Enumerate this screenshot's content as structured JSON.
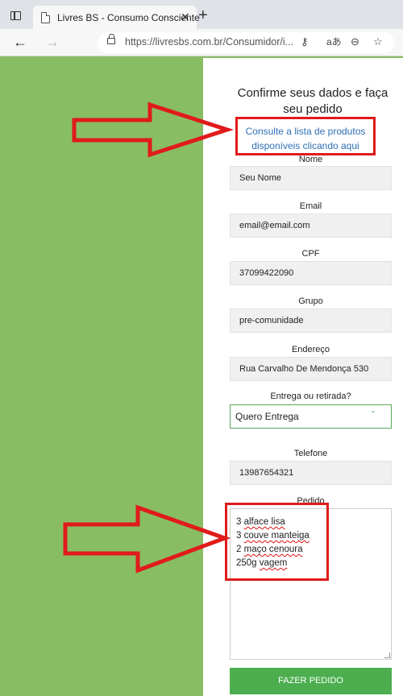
{
  "browser": {
    "tab_title": "Livres BS - Consumo Consciente",
    "tab_close": "✕",
    "new_tab": "+",
    "url": "https://livresbs.com.br/Consumidor/i...",
    "back_icon": "arrow-left-icon",
    "forward_icon": "arrow-right-icon",
    "reload_icon": "reload-icon"
  },
  "form": {
    "title": "Confirme seus dados e faça seu pedido",
    "consult_link": "Consulte a lista de produtos disponíveis clicando aqui",
    "fields": {
      "nome": {
        "label": "Nome",
        "value": "Seu Nome"
      },
      "email": {
        "label": "Email",
        "value": "email@email.com"
      },
      "cpf": {
        "label": "CPF",
        "value": "37099422090"
      },
      "grupo": {
        "label": "Grupo",
        "value": "pre-comunidade"
      },
      "endereco": {
        "label": "Endereço",
        "value": "Rua Carvalho De Mendonça 530"
      },
      "entrega": {
        "label": "Entrega ou retirada?",
        "value": "Quero Entrega"
      },
      "telefone": {
        "label": "Telefone",
        "value": "13987654321"
      },
      "pedido": {
        "label": "Pedido",
        "lines": [
          {
            "qty": "3",
            "item": "alface lisa"
          },
          {
            "qty": "3",
            "item": "couve manteiga"
          },
          {
            "qty": "2",
            "item": "maço cenoura"
          },
          {
            "qty": "250g",
            "item": "vagem"
          }
        ]
      }
    },
    "submit_label": "FAZER PEDIDO"
  },
  "colors": {
    "background_green": "#88bd63",
    "link_blue": "#2f6fb3",
    "button_green": "#4cae4f",
    "annotation_red": "#e01b1b"
  }
}
